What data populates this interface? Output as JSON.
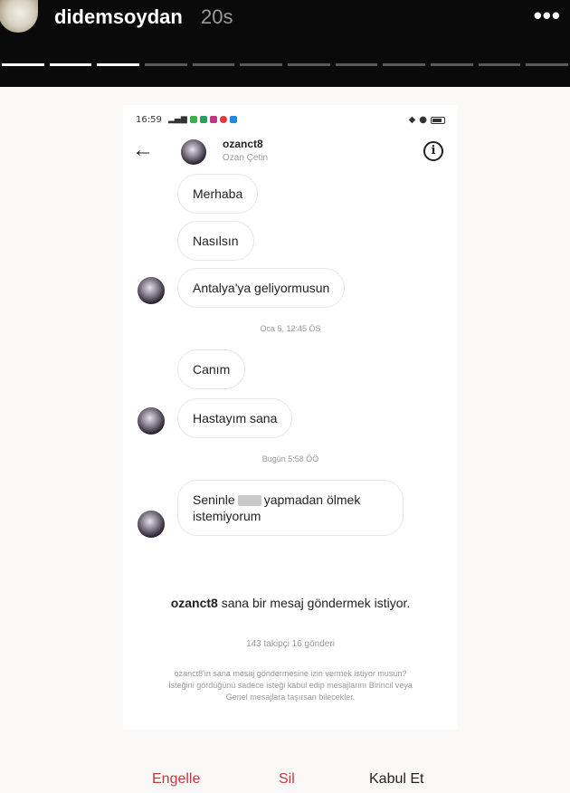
{
  "story": {
    "username": "didemsoydan",
    "time": "20s",
    "more_icon": "more-horizontal-icon",
    "progress_segments": 12,
    "progress_done": 3
  },
  "status_bar": {
    "time": "16:59"
  },
  "dm": {
    "username": "ozanct8",
    "full_name": "Ozan Çetin",
    "back_icon": "arrow-left-icon",
    "info_icon": "info-icon"
  },
  "messages": [
    {
      "text": "Merhaba"
    },
    {
      "text": "Nasılsın"
    },
    {
      "text": "Antalya'ya geliyormusun"
    },
    {
      "text": "Canım"
    },
    {
      "text": "Hastayım sana"
    },
    {
      "text_before": "Seninle",
      "text_after": "yapmadan ölmek",
      "text_line2": "istemiyorum"
    }
  ],
  "timestamps": [
    "Oca 5, 12:45 ÖS",
    "Bugün 5:58 ÖÖ"
  ],
  "request": {
    "username": "ozanct8",
    "title_rest": " sana bir mesaj göndermek istiyor.",
    "stats": "143 takipçi 16 gönderi",
    "description": "ozanct8'in sana mesaj göndermesine izin vermek istiyor musun? İsteğini gördüğünü sadece isteği kabul edip mesajlarını Birincil veya Genel mesajlara taşırsan bilecekler."
  },
  "actions": {
    "block": "Engelle",
    "delete": "Sil",
    "accept": "Kabul Et"
  },
  "colors": {
    "action_red": "#c23b3b",
    "story_bg": "#0a0a0a"
  }
}
